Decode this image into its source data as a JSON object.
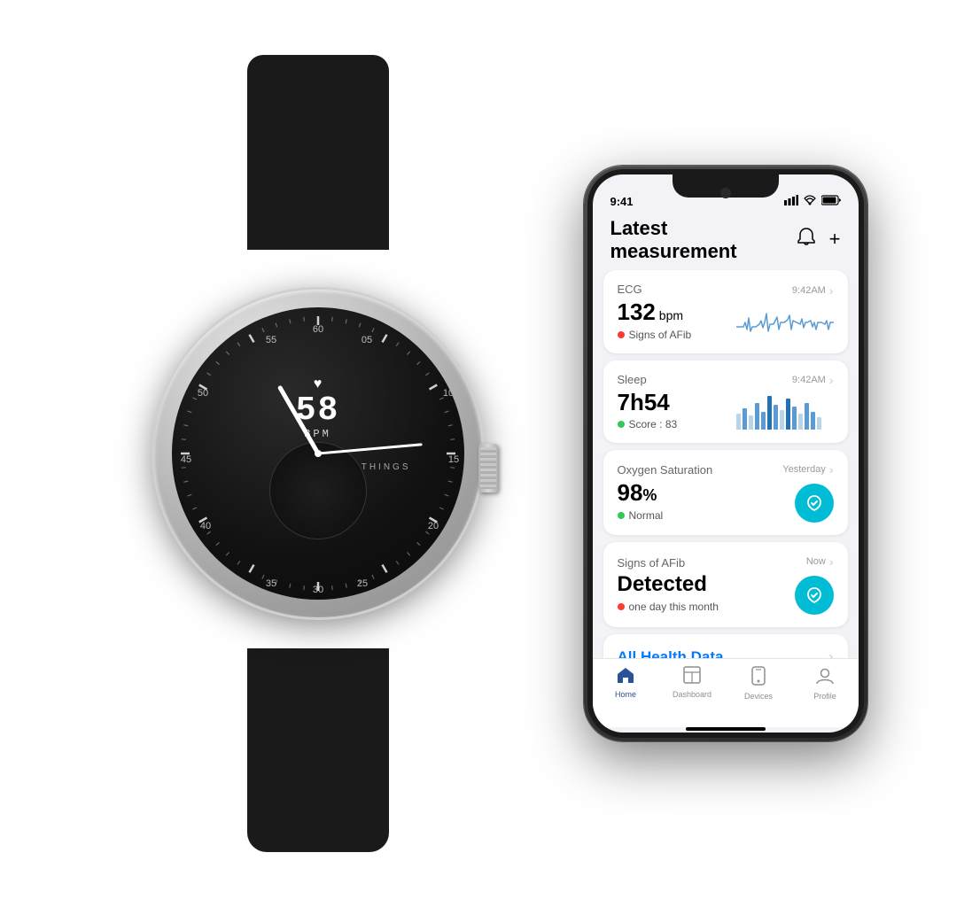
{
  "watch": {
    "brand": "WITHINGS",
    "bpm_number": "58",
    "bpm_label": "BPM",
    "heart_icon": "♥"
  },
  "phone": {
    "status_bar": {
      "time": "9:41",
      "signal": "▌▌▌",
      "wifi": "▲",
      "battery": "▮"
    },
    "header": {
      "title": "Latest measurement",
      "bell_icon": "🔔",
      "plus_icon": "+"
    },
    "cards": [
      {
        "type": "ECG",
        "value": "132",
        "unit": " bpm",
        "status_dot": "red",
        "status_text": "Signs of AFib",
        "time": "9:42AM",
        "chart_type": "ecg"
      },
      {
        "type": "Sleep",
        "value": "7h54",
        "unit": "",
        "status_dot": "green",
        "status_text": "Score : 83",
        "time": "9:42AM",
        "chart_type": "sleep"
      },
      {
        "type": "Oxygen Saturation",
        "value": "98",
        "unit": "%",
        "status_dot": "green",
        "status_text": "Normal",
        "time": "Yesterday",
        "chart_type": "o2"
      },
      {
        "type": "Signs of AFib",
        "value": "Detected",
        "unit": "",
        "status_dot": "red",
        "status_text": "one day this month",
        "time": "Now",
        "chart_type": "afib"
      }
    ],
    "all_health": {
      "label": "All Health Data",
      "chevron": "›"
    },
    "tabs": [
      {
        "id": "home",
        "label": "Home",
        "icon": "home",
        "active": true
      },
      {
        "id": "dashboard",
        "label": "Dashboard",
        "icon": "dashboard",
        "active": false
      },
      {
        "id": "devices",
        "label": "Devices",
        "icon": "devices",
        "active": false
      },
      {
        "id": "profile",
        "label": "Profile",
        "icon": "profile",
        "active": false
      }
    ]
  }
}
